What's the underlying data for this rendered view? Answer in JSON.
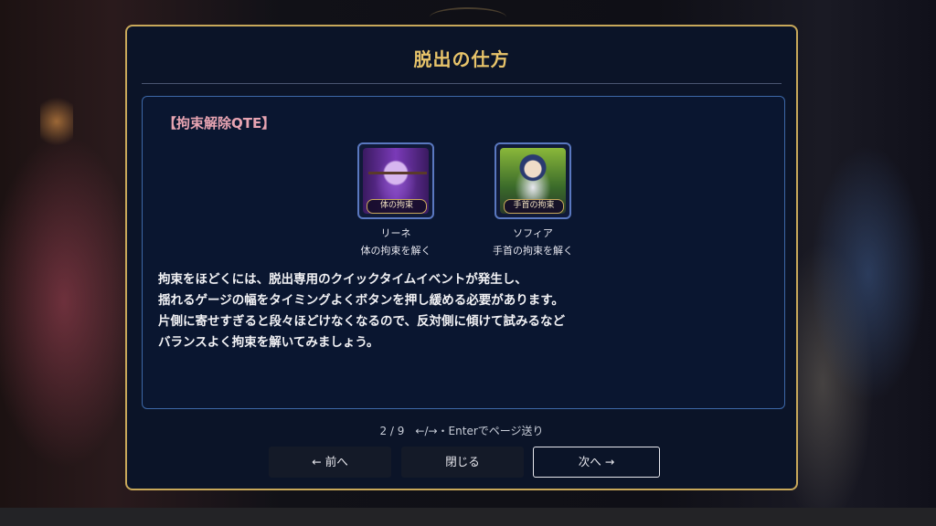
{
  "dialog": {
    "title": "脱出の仕方",
    "section_heading": "【拘束解除QTE】",
    "characters": [
      {
        "name": "リーネ",
        "action": "体の拘束を解く",
        "card_label": "体の拘束"
      },
      {
        "name": "ソフィア",
        "action": "手首の拘束を解く",
        "card_label": "手首の拘束"
      }
    ],
    "description": [
      "拘束をほどくには、脱出専用のクイックタイムイベントが発生し、",
      "揺れるゲージの幅をタイミングよくボタンを押し緩める必要があります。",
      "片側に寄せすぎると段々ほどけなくなるので、反対側に傾けて試みるなど",
      "バランスよく拘束を解いてみましょう。"
    ],
    "pager": "2 / 9　←/→・Enterでページ送り",
    "buttons": {
      "prev": "← 前へ",
      "close": "閉じる",
      "next": "次へ →"
    }
  },
  "colors": {
    "title": "#e8c46a",
    "panel_border": "#c8a85a",
    "heading": "#e8a4b2",
    "content_border": "#3d68a8"
  }
}
